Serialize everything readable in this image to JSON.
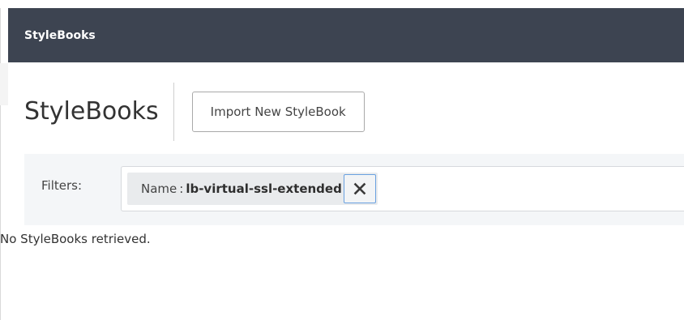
{
  "header": {
    "title": "StyleBooks"
  },
  "page": {
    "title": "StyleBooks",
    "import_button_label": "Import New StyleBook"
  },
  "filters": {
    "label": "Filters:",
    "active": [
      {
        "key": "Name",
        "separator": ":",
        "value": "lb-virtual-ssl-extended",
        "remove_icon": "close-icon"
      }
    ]
  },
  "results": {
    "empty_message": "No StyleBooks retrieved."
  },
  "colors": {
    "header_bg": "#3d4451",
    "filters_panel_bg": "#f4f6f8",
    "chip_bg": "#e9ebed",
    "focus_outline": "#6aa1e0"
  }
}
